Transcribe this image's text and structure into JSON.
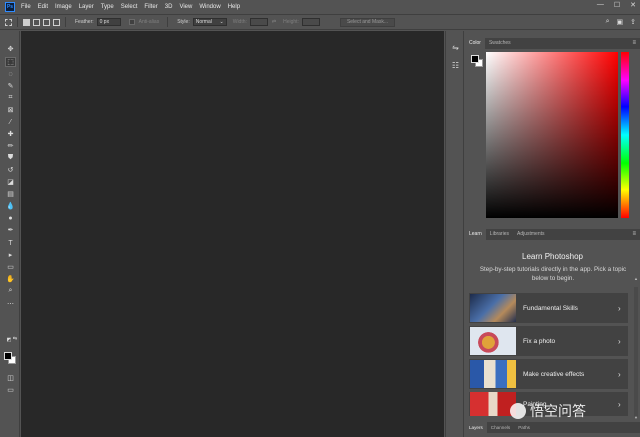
{
  "app": {
    "logo": "Ps"
  },
  "menu": [
    "File",
    "Edit",
    "Image",
    "Layer",
    "Type",
    "Select",
    "Filter",
    "3D",
    "View",
    "Window",
    "Help"
  ],
  "window_controls": {
    "minimize": "—",
    "maximize": "☐",
    "close": "✕"
  },
  "options_bar": {
    "feather_label": "Feather:",
    "feather_value": "0 px",
    "anti_alias_label": "Anti-alias",
    "style_label": "Style:",
    "style_value": "Normal",
    "width_label": "Width:",
    "height_label": "Height:",
    "select_mask_label": "Select and Mask..."
  },
  "panels": {
    "color": {
      "tabs": [
        "Color",
        "Swatches"
      ],
      "foreground": "#000000",
      "background": "#ffffff"
    },
    "learn": {
      "tabs": [
        "Learn",
        "Libraries",
        "Adjustments"
      ],
      "title": "Learn Photoshop",
      "subtitle": "Step-by-step tutorials directly in the app. Pick a topic below to begin.",
      "items": [
        "Fundamental Skills",
        "Fix a photo",
        "Make creative effects",
        "Painting"
      ]
    },
    "bottom_tabs": [
      "Layers",
      "Channels",
      "Paths"
    ]
  },
  "watermark": "悟空问答",
  "icons": {
    "move": "✥",
    "marquee": "⬚",
    "lasso": "◌",
    "quick-select": "✎",
    "crop": "⌗",
    "frame": "⊠",
    "eyedropper": "⁄",
    "healing": "✚",
    "brush": "✏",
    "stamp": "⛊",
    "history-brush": "↺",
    "eraser": "◪",
    "gradient": "▤",
    "blur": "💧",
    "dodge": "●",
    "pen": "✒",
    "type": "T",
    "path-select": "▸",
    "rectangle": "▭",
    "hand": "✋",
    "zoom": "⌕",
    "more": "⋯",
    "search": "⌕",
    "arrange": "▣",
    "share": "⇪",
    "chevron-right": "›"
  }
}
